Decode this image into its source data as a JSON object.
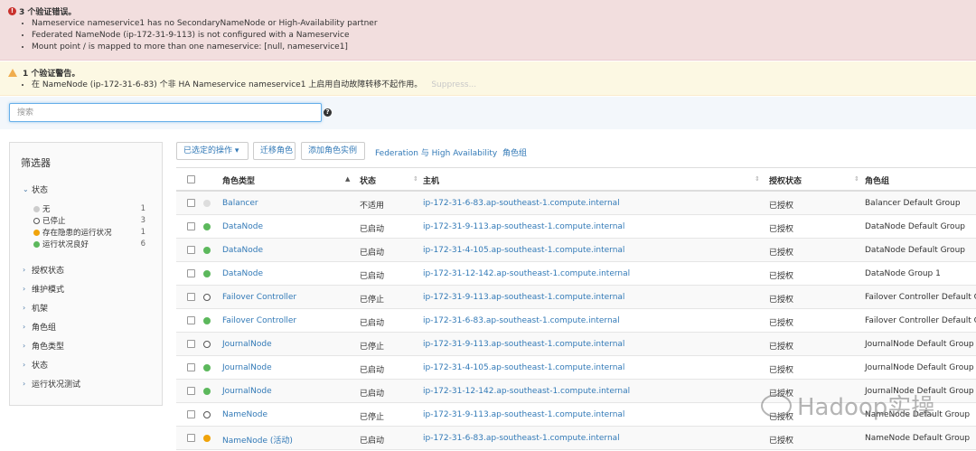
{
  "errors": {
    "title": "3 个验证错误。",
    "items": [
      "Nameservice nameservice1 has no SecondaryNameNode or High-Availability partner",
      "Federated NameNode (ip-172-31-9-113) is not configured with a Nameservice",
      "Mount point / is mapped to more than one nameservice: [null, nameservice1]"
    ]
  },
  "warnings": {
    "title": "1 个验证警告。",
    "items": [
      "在 NameNode (ip-172-31-6-83) 个非 HA Nameservice nameservice1 上启用自动故障转移不起作用。"
    ],
    "suppress": "Suppress..."
  },
  "search": {
    "placeholder": "搜索",
    "help": "?"
  },
  "filters": {
    "title": "筛选器",
    "status_label": "状态",
    "status_items": [
      {
        "label": "无",
        "count": "1"
      },
      {
        "label": "已停止",
        "count": "3"
      },
      {
        "label": "存在隐患的运行状况",
        "count": "1"
      },
      {
        "label": "运行状况良好",
        "count": "6"
      }
    ],
    "sections": [
      "授权状态",
      "维护模式",
      "机架",
      "角色组",
      "角色类型",
      "状态",
      "运行状况测试"
    ]
  },
  "toolbar": {
    "selected_actions": "已选定的操作",
    "migrate": "迁移角色",
    "add_instance": "添加角色实例",
    "federation": "Federation 与 High Availability",
    "role_groups": "角色组"
  },
  "table": {
    "headers": {
      "role_type": "角色类型",
      "state": "状态",
      "host": "主机",
      "commission": "授权状态",
      "role_group": "角色组"
    },
    "rows": [
      {
        "status": "none",
        "role": "Balancer",
        "state": "不适用",
        "host": "ip-172-31-6-83.ap-southeast-1.compute.internal",
        "commission": "已授权",
        "group": "Balancer Default Group"
      },
      {
        "status": "good",
        "role": "DataNode",
        "state": "已启动",
        "host": "ip-172-31-9-113.ap-southeast-1.compute.internal",
        "commission": "已授权",
        "group": "DataNode Default Group"
      },
      {
        "status": "good",
        "role": "DataNode",
        "state": "已启动",
        "host": "ip-172-31-4-105.ap-southeast-1.compute.internal",
        "commission": "已授权",
        "group": "DataNode Default Group"
      },
      {
        "status": "good",
        "role": "DataNode",
        "state": "已启动",
        "host": "ip-172-31-12-142.ap-southeast-1.compute.internal",
        "commission": "已授权",
        "group": "DataNode Group 1"
      },
      {
        "status": "stopped",
        "role": "Failover Controller",
        "state": "已停止",
        "host": "ip-172-31-9-113.ap-southeast-1.compute.internal",
        "commission": "已授权",
        "group": "Failover Controller Default Group"
      },
      {
        "status": "good",
        "role": "Failover Controller",
        "state": "已启动",
        "host": "ip-172-31-6-83.ap-southeast-1.compute.internal",
        "commission": "已授权",
        "group": "Failover Controller Default Group"
      },
      {
        "status": "stopped",
        "role": "JournalNode",
        "state": "已停止",
        "host": "ip-172-31-9-113.ap-southeast-1.compute.internal",
        "commission": "已授权",
        "group": "JournalNode Default Group"
      },
      {
        "status": "good",
        "role": "JournalNode",
        "state": "已启动",
        "host": "ip-172-31-4-105.ap-southeast-1.compute.internal",
        "commission": "已授权",
        "group": "JournalNode Default Group"
      },
      {
        "status": "good",
        "role": "JournalNode",
        "state": "已启动",
        "host": "ip-172-31-12-142.ap-southeast-1.compute.internal",
        "commission": "已授权",
        "group": "JournalNode Default Group"
      },
      {
        "status": "stopped",
        "role": "NameNode",
        "state": "已停止",
        "host": "ip-172-31-9-113.ap-southeast-1.compute.internal",
        "commission": "已授权",
        "group": "NameNode Default Group"
      },
      {
        "status": "concern",
        "role": "NameNode (活动)",
        "state": "已启动",
        "host": "ip-172-31-6-83.ap-southeast-1.compute.internal",
        "commission": "已授权",
        "group": "NameNode Default Group"
      }
    ]
  },
  "watermark": "Hadoop实操",
  "colors": {
    "link": "#337ab7",
    "good": "#5cb85c",
    "concern": "#f0a30a",
    "error": "#c9302c",
    "warning": "#f0ad4e"
  }
}
